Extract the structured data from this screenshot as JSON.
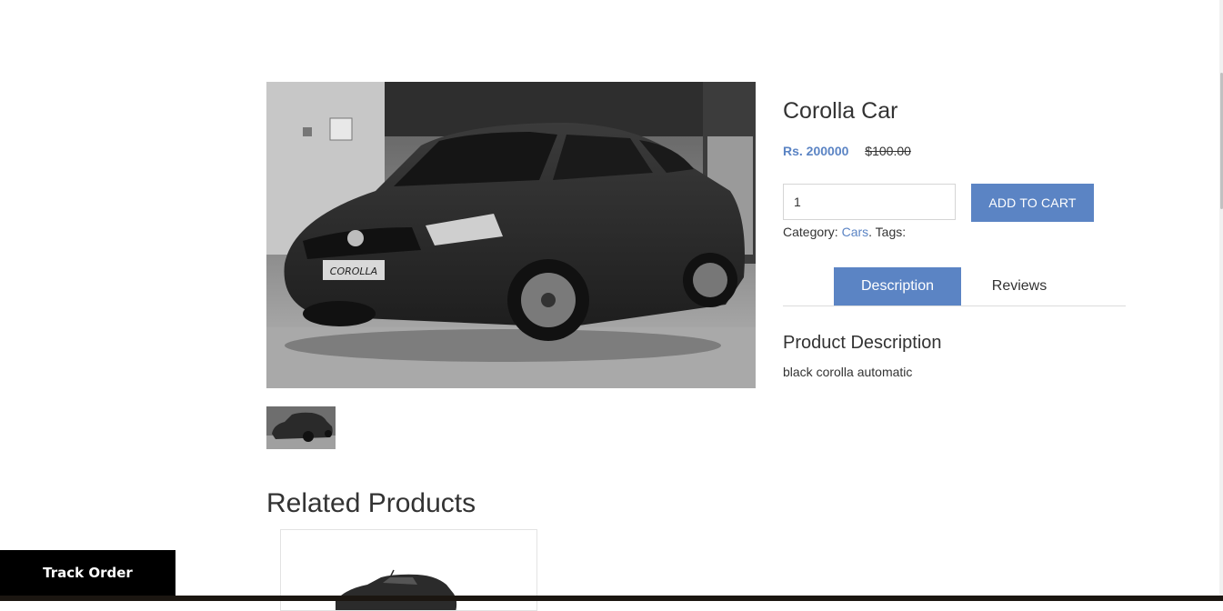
{
  "product": {
    "title": "Corolla Car",
    "price_sale": "Rs. 200000",
    "price_old": "$100.00",
    "quantity": "1",
    "add_to_cart_label": "ADD TO CART",
    "category_label": "Category:",
    "category_link": "Cars",
    "tags_label": ". Tags:",
    "main_image_icon": "car-photo",
    "badge_text": "COROLLA"
  },
  "tabs": [
    {
      "label": "Description",
      "active": true
    },
    {
      "label": "Reviews",
      "active": false
    }
  ],
  "description": {
    "heading": "Product Description",
    "text": "black corolla automatic"
  },
  "related": {
    "heading": "Related Products"
  },
  "track_order": {
    "label": "Track Order"
  },
  "colors": {
    "accent": "#5b84c4",
    "text": "#333333",
    "track_bg": "#000000"
  }
}
